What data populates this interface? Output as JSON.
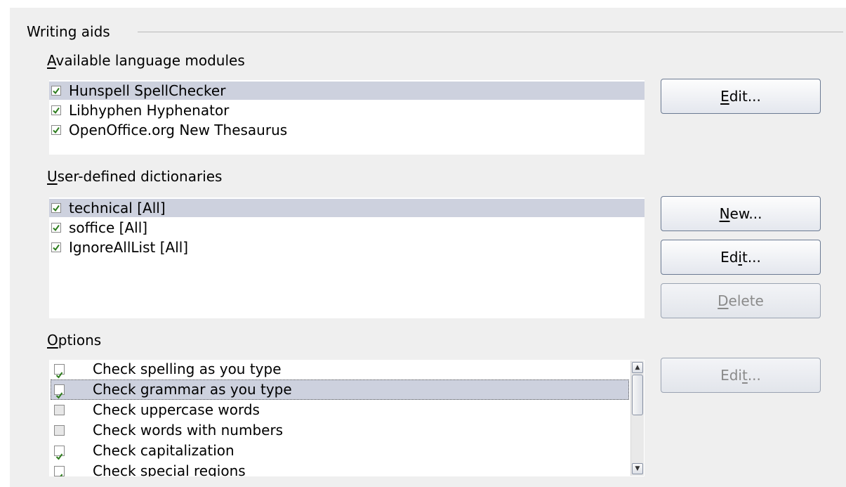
{
  "group": {
    "title": "Writing aids"
  },
  "modules": {
    "label_accel": "A",
    "label_rest": "vailable language modules",
    "items": [
      {
        "label": "Hunspell SpellChecker",
        "checked": true,
        "selected": true
      },
      {
        "label": "Libhyphen Hyphenator",
        "checked": true,
        "selected": false
      },
      {
        "label": "OpenOffice.org New Thesaurus",
        "checked": true,
        "selected": false
      }
    ],
    "edit_button": {
      "accel": "E",
      "rest": "dit..."
    }
  },
  "dictionaries": {
    "label_accel": "U",
    "label_rest": "ser-defined dictionaries",
    "items": [
      {
        "label": "technical [All]",
        "checked": true,
        "selected": true
      },
      {
        "label": "soffice [All]",
        "checked": true,
        "selected": false
      },
      {
        "label": "IgnoreAllList [All]",
        "checked": true,
        "selected": false
      }
    ],
    "new_button": {
      "accel": "N",
      "rest": "ew..."
    },
    "edit_button": {
      "pre": "Ed",
      "accel": "i",
      "rest": "t..."
    },
    "delete_button": {
      "accel": "D",
      "rest": "elete"
    }
  },
  "options": {
    "label_accel": "O",
    "label_rest": "ptions",
    "items": [
      {
        "label": "Check spelling as you type",
        "checked": true,
        "selected": false
      },
      {
        "label": "Check grammar as you type",
        "checked": true,
        "selected": true
      },
      {
        "label": "Check uppercase words",
        "checked": false,
        "selected": false
      },
      {
        "label": "Check words with numbers",
        "checked": false,
        "selected": false
      },
      {
        "label": "Check capitalization",
        "checked": true,
        "selected": false
      },
      {
        "label": "Check special regions",
        "checked": true,
        "selected": false
      }
    ],
    "edit_button": {
      "pre": "Edi",
      "accel": "t",
      "rest": "..."
    }
  },
  "colors": {
    "selection": "#cdd1de",
    "check_green": "#2e7d1e",
    "panel": "#efefef"
  }
}
